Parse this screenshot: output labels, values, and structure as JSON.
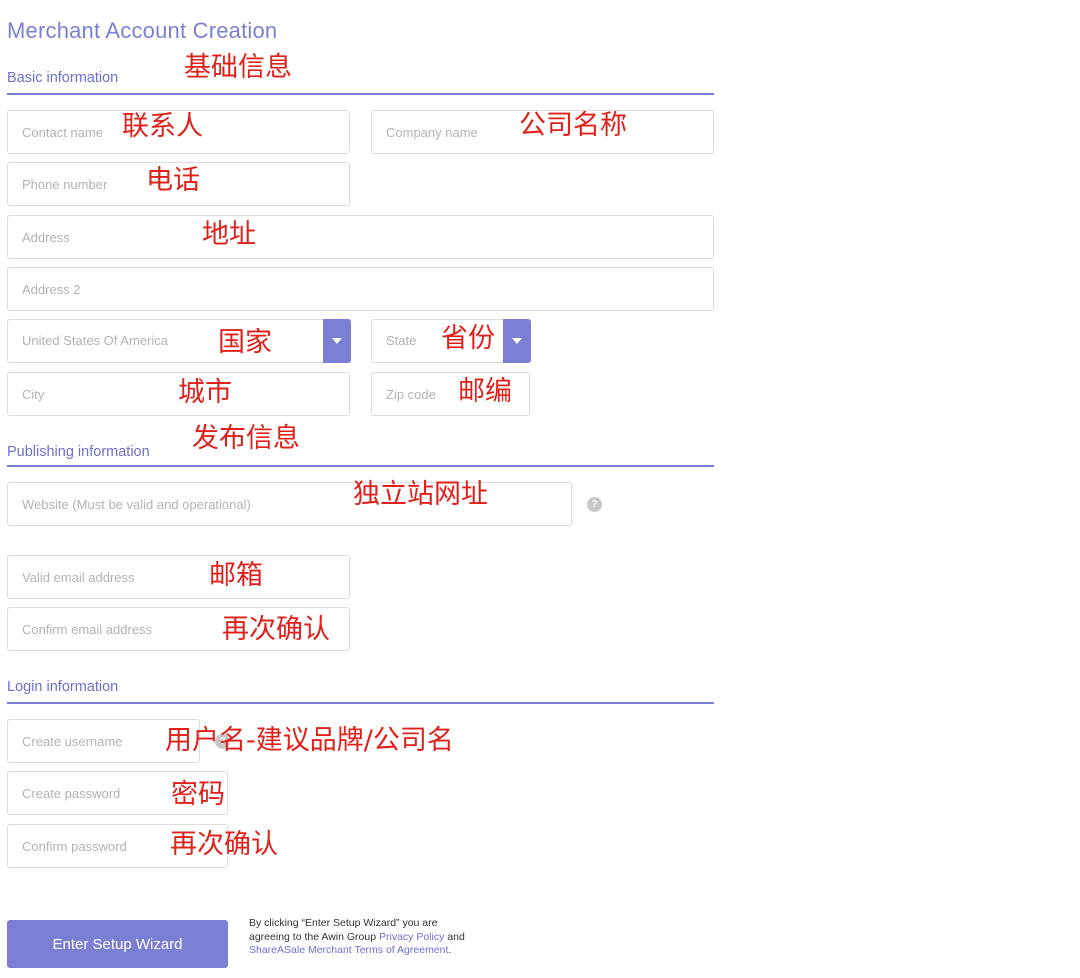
{
  "page": {
    "title": "Merchant Account Creation"
  },
  "colors": {
    "accent": "#7b7fd4",
    "annotation": "#e0211b",
    "border": "#dcdcdc"
  },
  "sections": {
    "basic": {
      "label": "Basic information",
      "annotation": "基础信息"
    },
    "publishing": {
      "label": "Publishing information",
      "annotation": "发布信息"
    },
    "login": {
      "label": "Login information"
    }
  },
  "fields": {
    "contact_name": {
      "placeholder": "Contact name",
      "value": "",
      "annotation": "联系人"
    },
    "company_name": {
      "placeholder": "Company name",
      "value": "",
      "annotation": "公司名称"
    },
    "phone": {
      "placeholder": "Phone number",
      "value": "",
      "annotation": "电话"
    },
    "address": {
      "placeholder": "Address",
      "value": "",
      "annotation": "地址"
    },
    "address2": {
      "placeholder": "Address 2",
      "value": ""
    },
    "country": {
      "selected": "United States Of America",
      "annotation": "国家"
    },
    "state": {
      "selected": "State",
      "annotation": "省份"
    },
    "city": {
      "placeholder": "City",
      "value": "",
      "annotation": "城市"
    },
    "zip": {
      "placeholder": "Zip code",
      "value": "",
      "annotation": "邮编"
    },
    "website": {
      "placeholder": "Website (Must be valid and operational)",
      "value": "",
      "annotation": "独立站网址",
      "help_icon": "question-circle-icon"
    },
    "email": {
      "placeholder": "Valid email address",
      "value": "",
      "annotation": "邮箱"
    },
    "email_confirm": {
      "placeholder": "Confirm email address",
      "value": "",
      "annotation": "再次确认"
    },
    "username": {
      "placeholder": "Create username",
      "value": "",
      "annotation": "用户名-建议品牌/公司名",
      "help_icon": "question-circle-icon"
    },
    "password": {
      "placeholder": "Create password",
      "value": "",
      "annotation": "密码"
    },
    "password_confirm": {
      "placeholder": "Confirm password",
      "value": "",
      "annotation": "再次确认"
    }
  },
  "footer": {
    "submit_label": "Enter Setup Wizard",
    "terms_prefix": "By clicking “Enter Setup Wizard” you are agreeing to the Awin Group ",
    "privacy_link": "Privacy Policy",
    "terms_and": " and ",
    "terms_link": "ShareASale Merchant Terms of Agreement",
    "terms_suffix": "."
  }
}
